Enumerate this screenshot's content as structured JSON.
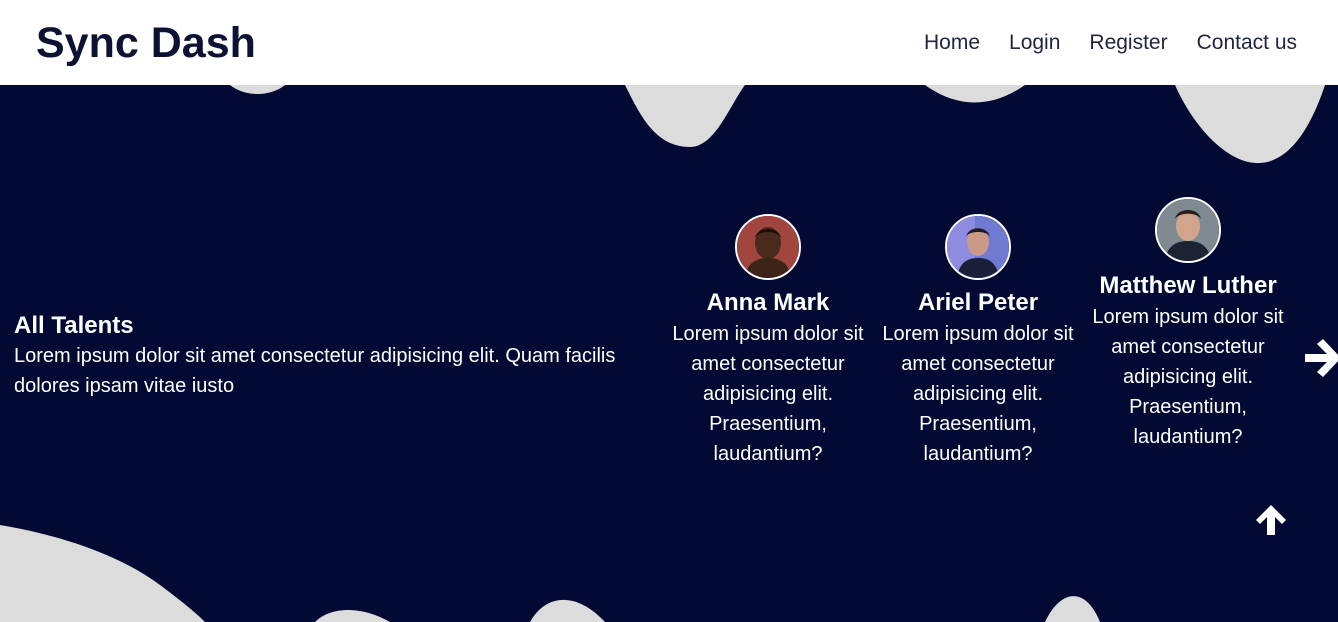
{
  "header": {
    "brand": "Sync Dash",
    "nav": [
      "Home",
      "Login",
      "Register",
      "Contact us"
    ]
  },
  "intro": {
    "title": "All Talents",
    "text": "Lorem ipsum dolor sit amet consectetur adipisicing elit. Quam facilis dolores ipsam vitae iusto"
  },
  "talents": [
    {
      "name": "Anna Mark",
      "bio": "Lorem ipsum dolor sit amet consectetur adipisicing elit. Praesentium, laudantium?"
    },
    {
      "name": "Ariel Peter",
      "bio": "Lorem ipsum dolor sit amet consectetur adipisicing elit. Praesentium, laudantium?"
    },
    {
      "name": "Matthew Luther",
      "bio": "Lorem ipsum dolor sit amet consectetur adipisicing elit. Praesentium, laudantium?"
    }
  ],
  "icons": {
    "next": "arrow-right-icon",
    "top": "arrow-up-icon"
  },
  "colors": {
    "hero_bg": "#020a33",
    "blob": "#dcdcdc",
    "brand_text": "#0b1233"
  }
}
